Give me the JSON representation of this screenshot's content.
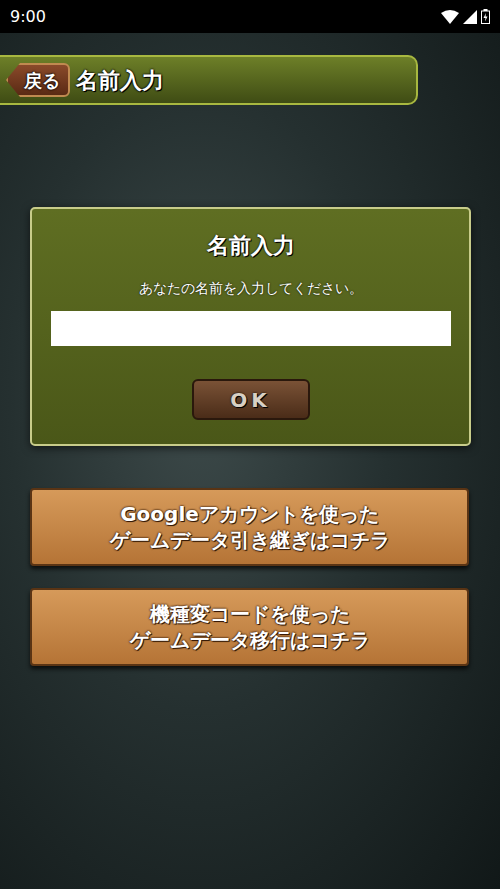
{
  "status_bar": {
    "time": "9:00"
  },
  "header": {
    "back": "戻る",
    "title": "名前入力"
  },
  "dialog": {
    "title": "名前入力",
    "message": "あなたの名前を入力してください。",
    "ok": "OK"
  },
  "buttons": [
    {
      "lines": [
        "Googleアカウントを使った",
        "ゲームデータ引き継ぎはコチラ"
      ]
    },
    {
      "lines": [
        "機種変コードを使った",
        "ゲームデータ移行はコチラ"
      ]
    }
  ]
}
